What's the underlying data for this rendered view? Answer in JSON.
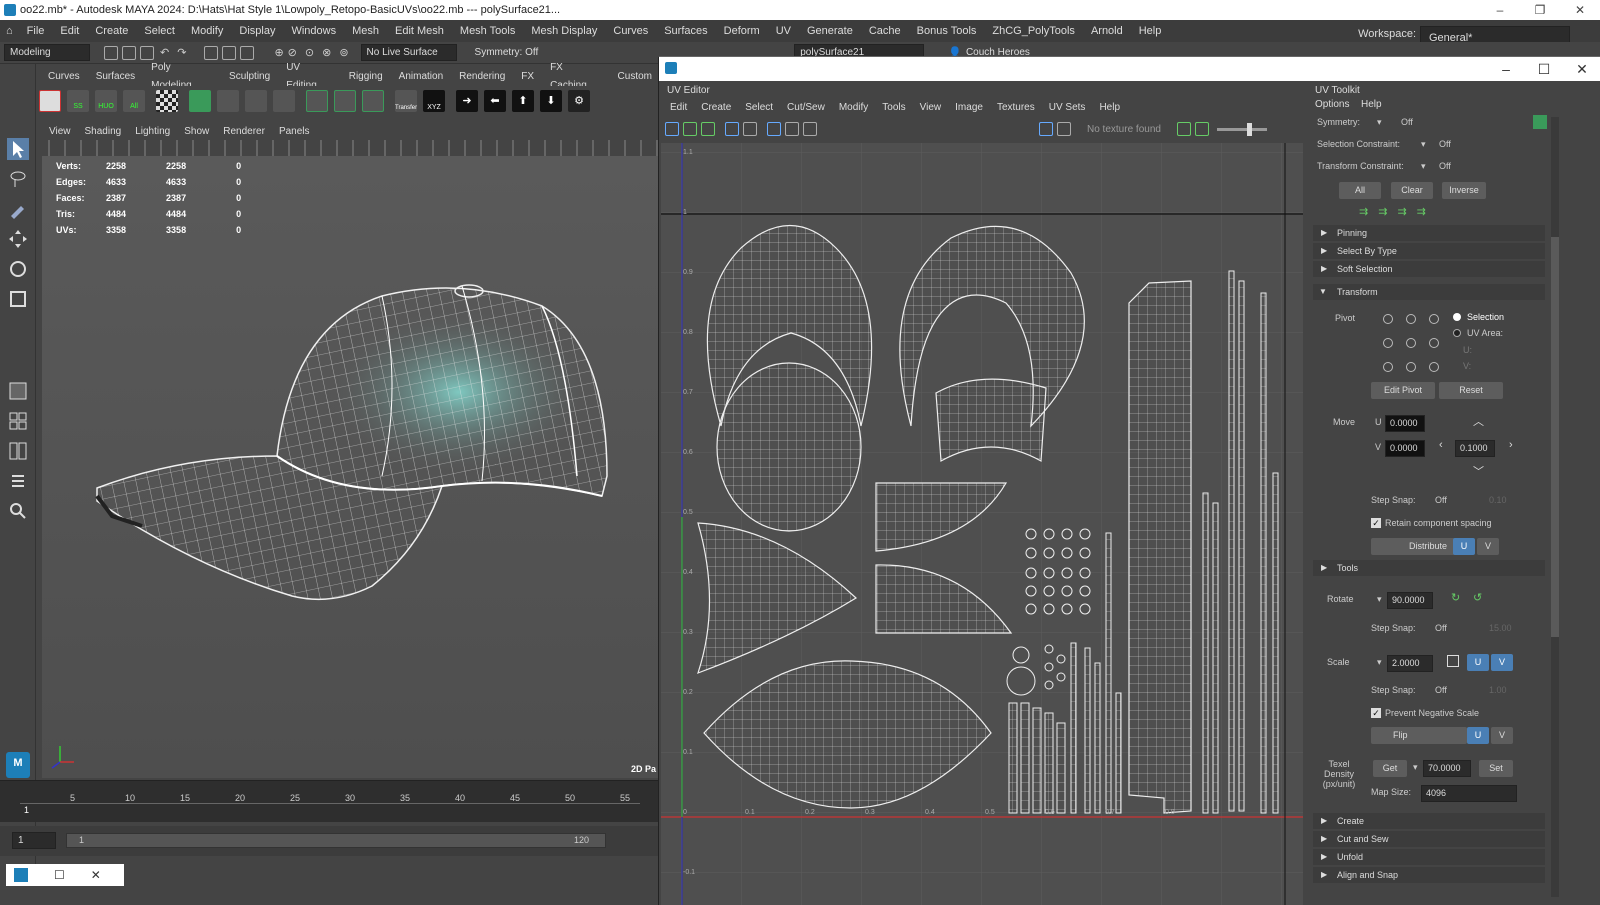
{
  "window": {
    "title": "oo22.mb* - Autodesk MAYA 2024: D:\\Hats\\Hat Style 1\\Lowpoly_Retopo-BasicUVs\\oo22.mb  ---  polySurface21..."
  },
  "main_menu": [
    "File",
    "Edit",
    "Create",
    "Select",
    "Modify",
    "Display",
    "Windows",
    "Mesh",
    "Edit Mesh",
    "Mesh Tools",
    "Mesh Display",
    "Curves",
    "Surfaces",
    "Deform",
    "UV",
    "Generate",
    "Cache",
    "Bonus Tools",
    "ZhCG_PolyTools",
    "Arnold",
    "Help"
  ],
  "workspace": {
    "label": "Workspace:",
    "value": "General*"
  },
  "status_line": {
    "mode": "Modeling",
    "live_surface": "No Live Surface",
    "symmetry": "Symmetry: Off",
    "object_name": "polySurface21",
    "user": "Couch Heroes"
  },
  "shelf_tabs": [
    "Curves",
    "Surfaces",
    "Poly Modeling",
    "Sculpting",
    "UV Editing",
    "Rigging",
    "Animation",
    "Rendering",
    "FX",
    "FX Caching",
    "Custom"
  ],
  "shelf_labels": {
    "ss": "SS",
    "huo": "HUO",
    "all": "All",
    "transfer": "Transfer",
    "xyz": "XYZ"
  },
  "viewport": {
    "menu": [
      "View",
      "Shading",
      "Lighting",
      "Show",
      "Renderer",
      "Panels"
    ],
    "hud": [
      {
        "label": "Verts:",
        "a": "2258",
        "b": "2258",
        "c": "0"
      },
      {
        "label": "Edges:",
        "a": "4633",
        "b": "4633",
        "c": "0"
      },
      {
        "label": "Faces:",
        "a": "2387",
        "b": "2387",
        "c": "0"
      },
      {
        "label": "Tris:",
        "a": "4484",
        "b": "4484",
        "c": "0"
      },
      {
        "label": "UVs:",
        "a": "3358",
        "b": "3358",
        "c": "0"
      }
    ],
    "corner_label": "2D Pa",
    "maya_badge": "M"
  },
  "timeline": {
    "ticks": [
      "5",
      "10",
      "15",
      "20",
      "25",
      "30",
      "35",
      "40",
      "45",
      "50",
      "55"
    ],
    "current_frame": "1",
    "range_start": "1",
    "range_inner_start": "1",
    "range_end": "120"
  },
  "uv_editor": {
    "label": "UV Editor",
    "menu": [
      "Edit",
      "Create",
      "Select",
      "Cut/Sew",
      "Modify",
      "Tools",
      "View",
      "Image",
      "Textures",
      "UV Sets",
      "Help"
    ],
    "texture_status": "No texture found",
    "v_ticks": [
      "1.1",
      "1",
      "0.9",
      "0.8",
      "0.7",
      "0.6",
      "0.5",
      "0.4",
      "0.3",
      "0.2",
      "0.1",
      "0",
      "-0.1"
    ],
    "u_ticks": [
      "0.1",
      "0.2",
      "0.3",
      "0.4",
      "0.5",
      "0.6",
      "0.7",
      "0.8"
    ]
  },
  "uv_toolkit": {
    "title": "UV Toolkit",
    "menu": [
      "Options",
      "Help"
    ],
    "symmetry": {
      "label": "Symmetry:",
      "value": "Off"
    },
    "selection_constraint": {
      "label": "Selection Constraint:",
      "value": "Off"
    },
    "transform_constraint": {
      "label": "Transform Constraint:",
      "value": "Off"
    },
    "buttons": {
      "all": "All",
      "clear": "Clear",
      "inverse": "Inverse"
    },
    "collapsed_top": [
      "Pinning",
      "Select By Type",
      "Soft Selection"
    ],
    "transform": {
      "header": "Transform",
      "pivot_label": "Pivot",
      "pivot_selection": "Selection",
      "pivot_uv_area": "UV Area:",
      "u_label": "U:",
      "v_label": "V:",
      "edit_pivot": "Edit Pivot",
      "reset": "Reset",
      "move_label": "Move",
      "move_u": "0.0000",
      "move_v": "0.0000",
      "move_step": "0.1000",
      "step_snap_label": "Step Snap:",
      "step_snap_value": "Off",
      "move_snap_amount": "0.10",
      "retain_spacing": "Retain component spacing",
      "distribute": "Distribute",
      "u_btn": "U",
      "v_btn": "V"
    },
    "tools_header": "Tools",
    "rotate": {
      "label": "Rotate",
      "value": "90.0000",
      "step_snap": "Off",
      "snap_amount": "15.00"
    },
    "scale": {
      "label": "Scale",
      "value": "2.0000",
      "step_snap": "Off",
      "snap_amount": "1.00"
    },
    "prevent_negative_scale": "Prevent Negative Scale",
    "flip": "Flip",
    "texel": {
      "label": "Texel Density (px/unit)",
      "get": "Get",
      "value": "70.0000",
      "set": "Set",
      "map_size_label": "Map Size:",
      "map_size": "4096"
    },
    "collapsed_bottom": [
      "Create",
      "Cut and Sew",
      "Unfold",
      "Align and Snap"
    ]
  },
  "colors": {
    "accent_blue": "#4a7fb5",
    "maya_teal": "#1d7fb8",
    "wire": "#e8e8e8"
  }
}
